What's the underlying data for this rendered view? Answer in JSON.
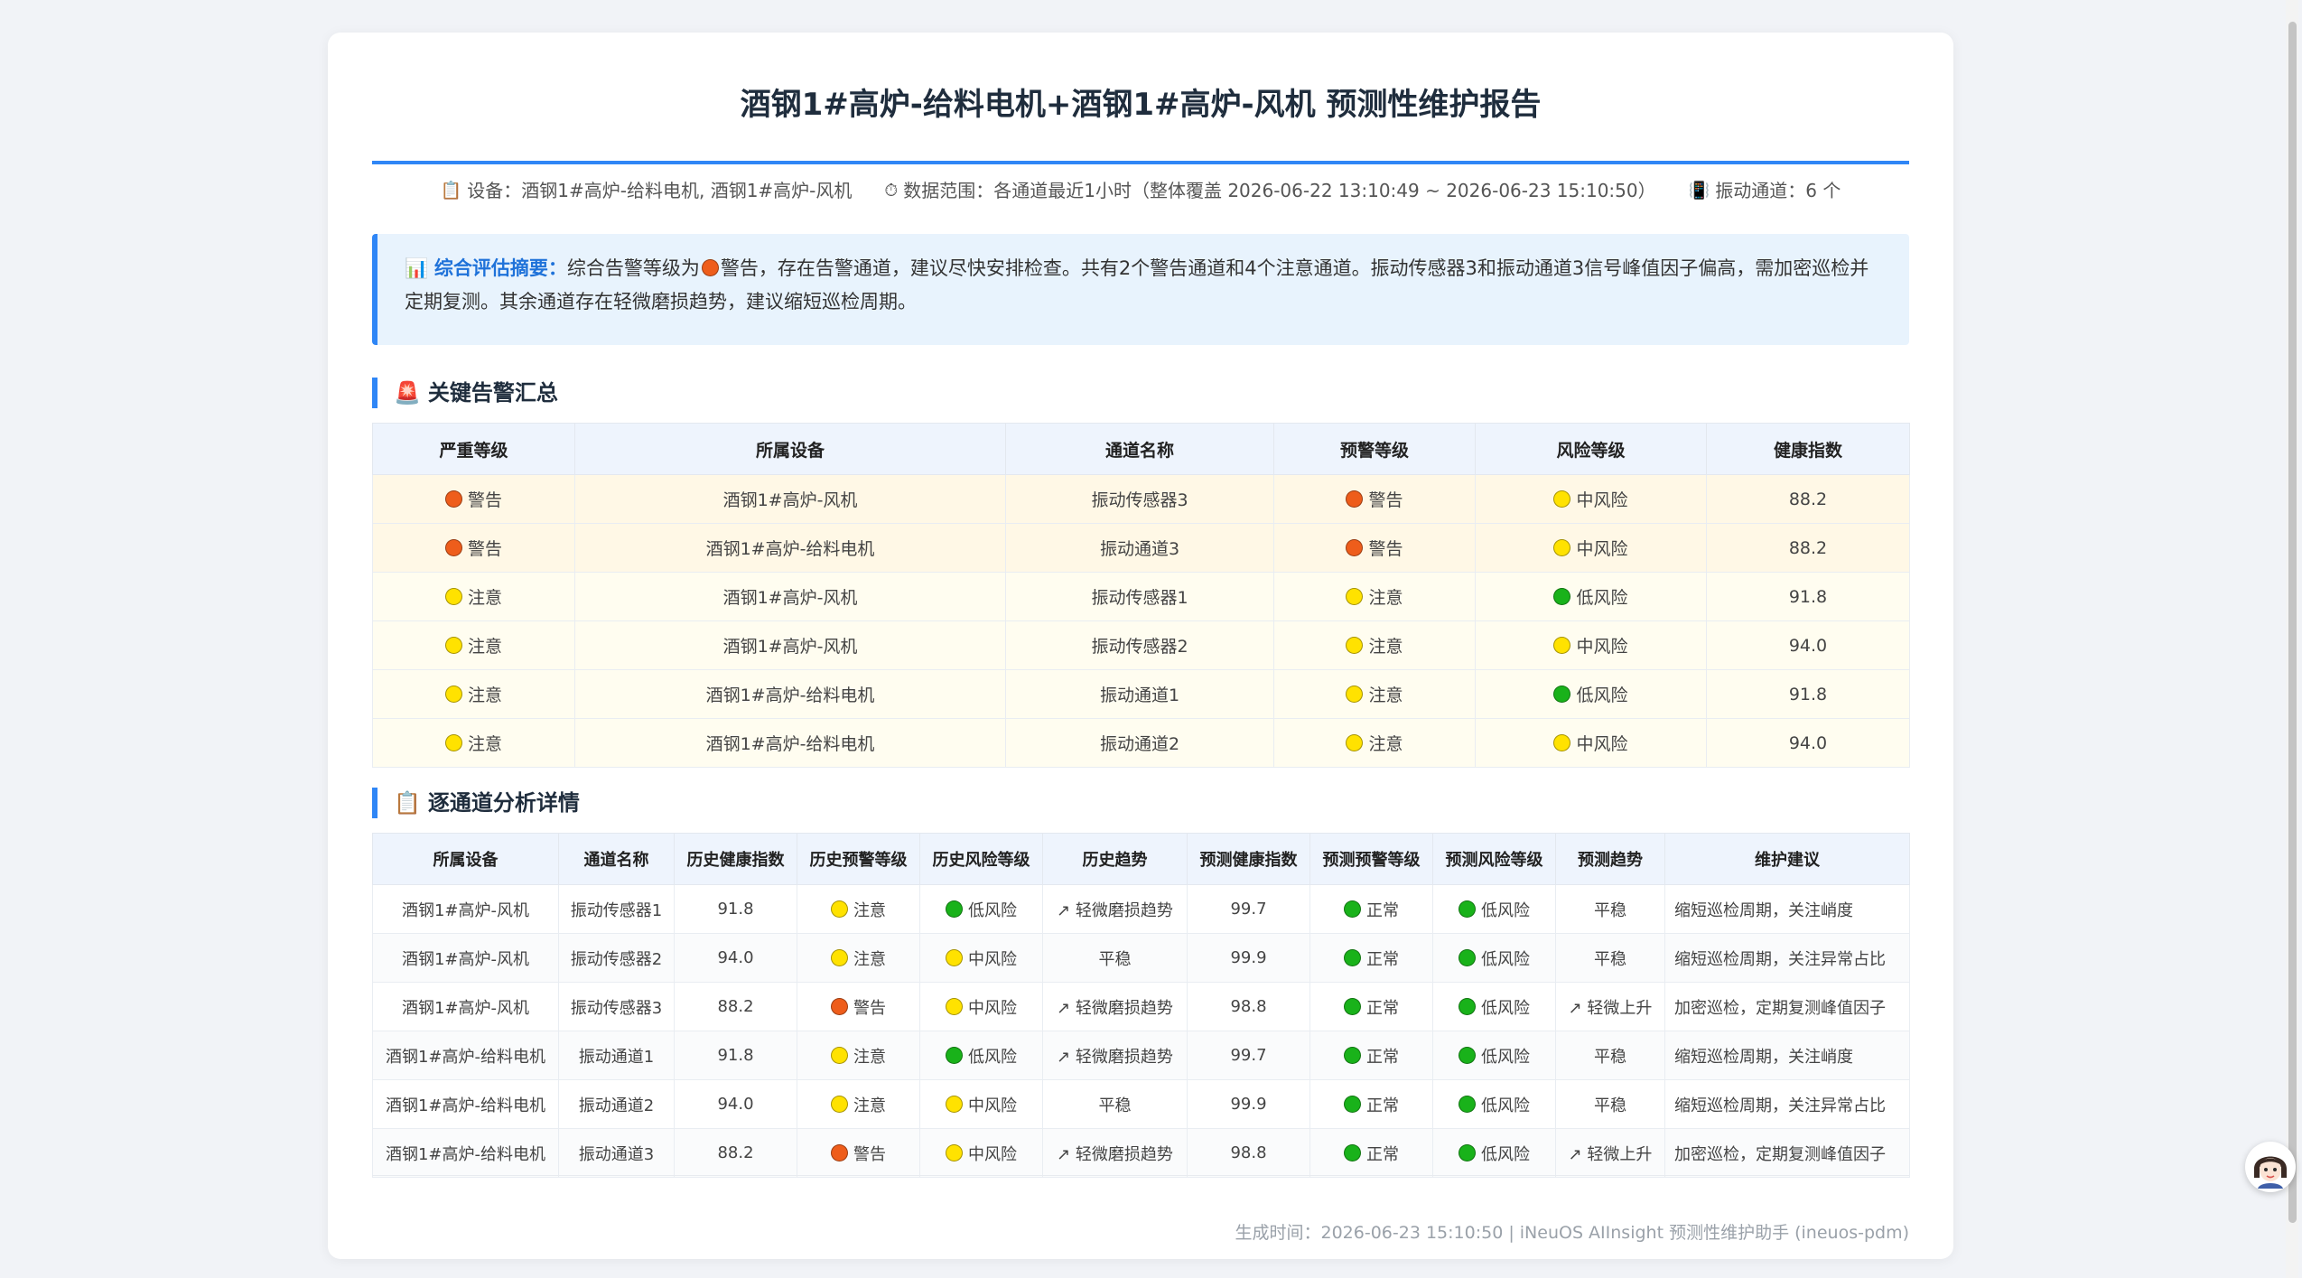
{
  "report": {
    "title": "酒钢1#高炉-给料电机+酒钢1#高炉-风机 预测性维护报告",
    "meta": {
      "device_icon": "clipboard-icon",
      "device": "设备：酒钢1#高炉-给料电机, 酒钢1#高炉-风机",
      "range_icon": "stopwatch-icon",
      "range": "数据范围：各通道最近1小时（整体覆盖 2026-06-22 13:10:49 ~ 2026-06-23 15:10:50）",
      "channels_icon": "vibration-icon",
      "channels": "振动通道：6 个"
    },
    "summary": {
      "icon": "bar-chart-icon",
      "label": "综合评估摘要：",
      "text_before": "综合告警等级为",
      "level_icon": "orange-circle",
      "text_after": "警告，存在告警通道，建议尽快安排检查。共有2个警告通道和4个注意通道。振动传感器3和振动通道3信号峰值因子偏高，需加密巡检并定期复测。其余通道存在轻微磨损趋势，建议缩短巡检周期。"
    },
    "alerts_section": {
      "icon": "siren-icon",
      "title": "关键告警汇总",
      "headers": [
        "严重等级",
        "所属设备",
        "通道名称",
        "预警等级",
        "风险等级",
        "健康指数"
      ],
      "rows": [
        {
          "severity": "警告",
          "severity_color": "orange",
          "device": "酒钢1#高炉-风机",
          "channel": "振动传感器3",
          "warn": "警告",
          "warn_color": "orange",
          "risk": "中风险",
          "risk_color": "yellow",
          "health": "88.2"
        },
        {
          "severity": "警告",
          "severity_color": "orange",
          "device": "酒钢1#高炉-给料电机",
          "channel": "振动通道3",
          "warn": "警告",
          "warn_color": "orange",
          "risk": "中风险",
          "risk_color": "yellow",
          "health": "88.2"
        },
        {
          "severity": "注意",
          "severity_color": "yellow",
          "device": "酒钢1#高炉-风机",
          "channel": "振动传感器1",
          "warn": "注意",
          "warn_color": "yellow",
          "risk": "低风险",
          "risk_color": "green",
          "health": "91.8"
        },
        {
          "severity": "注意",
          "severity_color": "yellow",
          "device": "酒钢1#高炉-风机",
          "channel": "振动传感器2",
          "warn": "注意",
          "warn_color": "yellow",
          "risk": "中风险",
          "risk_color": "yellow",
          "health": "94.0"
        },
        {
          "severity": "注意",
          "severity_color": "yellow",
          "device": "酒钢1#高炉-给料电机",
          "channel": "振动通道1",
          "warn": "注意",
          "warn_color": "yellow",
          "risk": "低风险",
          "risk_color": "green",
          "health": "91.8"
        },
        {
          "severity": "注意",
          "severity_color": "yellow",
          "device": "酒钢1#高炉-给料电机",
          "channel": "振动通道2",
          "warn": "注意",
          "warn_color": "yellow",
          "risk": "中风险",
          "risk_color": "yellow",
          "health": "94.0"
        }
      ]
    },
    "detail_section": {
      "icon": "clipboard-icon",
      "title": "逐通道分析详情",
      "headers": [
        "所属设备",
        "通道名称",
        "历史健康指数",
        "历史预警等级",
        "历史风险等级",
        "历史趋势",
        "预测健康指数",
        "预测预警等级",
        "预测风险等级",
        "预测趋势",
        "维护建议"
      ],
      "rows": [
        {
          "device": "酒钢1#高炉-风机",
          "channel": "振动传感器1",
          "hist_health": "91.8",
          "hist_warn": "注意",
          "hist_warn_color": "yellow",
          "hist_risk": "低风险",
          "hist_risk_color": "green",
          "hist_trend": "↗ 轻微磨损趋势",
          "pred_health": "99.7",
          "pred_warn": "正常",
          "pred_warn_color": "green",
          "pred_risk": "低风险",
          "pred_risk_color": "green",
          "pred_trend": "平稳",
          "advice": "缩短巡检周期，关注峭度"
        },
        {
          "device": "酒钢1#高炉-风机",
          "channel": "振动传感器2",
          "hist_health": "94.0",
          "hist_warn": "注意",
          "hist_warn_color": "yellow",
          "hist_risk": "中风险",
          "hist_risk_color": "yellow",
          "hist_trend": "平稳",
          "pred_health": "99.9",
          "pred_warn": "正常",
          "pred_warn_color": "green",
          "pred_risk": "低风险",
          "pred_risk_color": "green",
          "pred_trend": "平稳",
          "advice": "缩短巡检周期，关注异常占比"
        },
        {
          "device": "酒钢1#高炉-风机",
          "channel": "振动传感器3",
          "hist_health": "88.2",
          "hist_warn": "警告",
          "hist_warn_color": "orange",
          "hist_risk": "中风险",
          "hist_risk_color": "yellow",
          "hist_trend": "↗ 轻微磨损趋势",
          "pred_health": "98.8",
          "pred_warn": "正常",
          "pred_warn_color": "green",
          "pred_risk": "低风险",
          "pred_risk_color": "green",
          "pred_trend": "↗ 轻微上升",
          "advice": "加密巡检，定期复测峰值因子"
        },
        {
          "device": "酒钢1#高炉-给料电机",
          "channel": "振动通道1",
          "hist_health": "91.8",
          "hist_warn": "注意",
          "hist_warn_color": "yellow",
          "hist_risk": "低风险",
          "hist_risk_color": "green",
          "hist_trend": "↗ 轻微磨损趋势",
          "pred_health": "99.7",
          "pred_warn": "正常",
          "pred_warn_color": "green",
          "pred_risk": "低风险",
          "pred_risk_color": "green",
          "pred_trend": "平稳",
          "advice": "缩短巡检周期，关注峭度"
        },
        {
          "device": "酒钢1#高炉-给料电机",
          "channel": "振动通道2",
          "hist_health": "94.0",
          "hist_warn": "注意",
          "hist_warn_color": "yellow",
          "hist_risk": "中风险",
          "hist_risk_color": "yellow",
          "hist_trend": "平稳",
          "pred_health": "99.9",
          "pred_warn": "正常",
          "pred_warn_color": "green",
          "pred_risk": "低风险",
          "pred_risk_color": "green",
          "pred_trend": "平稳",
          "advice": "缩短巡检周期，关注异常占比"
        },
        {
          "device": "酒钢1#高炉-给料电机",
          "channel": "振动通道3",
          "hist_health": "88.2",
          "hist_warn": "警告",
          "hist_warn_color": "orange",
          "hist_risk": "中风险",
          "hist_risk_color": "yellow",
          "hist_trend": "↗ 轻微磨损趋势",
          "pred_health": "98.8",
          "pred_warn": "正常",
          "pred_warn_color": "green",
          "pred_risk": "低风险",
          "pred_risk_color": "green",
          "pred_trend": "↗ 轻微上升",
          "advice": "加密巡检，定期复测峰值因子"
        }
      ]
    },
    "footer": "生成时间：2026-06-23 15:10:50 | iNeuOS AIInsight 预测性维护助手 (ineuos-pdm)"
  },
  "assistant": {
    "icon": "assistant-avatar-icon"
  },
  "colors": {
    "accent": "#2f86f6",
    "warn": "#ee5d1b",
    "note": "#ffe200",
    "ok": "#19b21a"
  }
}
